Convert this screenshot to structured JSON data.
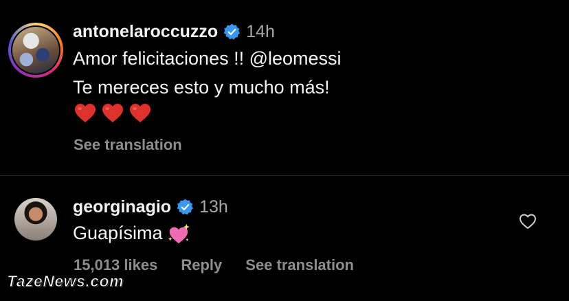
{
  "comments": [
    {
      "username": "antonelaroccuzzo",
      "time": "14h",
      "lines": [
        "Amor felicitaciones !! @leomessi",
        "Te mereces esto y mucho más!"
      ],
      "emoji": [
        "red-heart",
        "red-heart",
        "red-heart"
      ],
      "see_translation": "See translation"
    },
    {
      "username": "georginagio",
      "time": "13h",
      "text": "Guapísima",
      "emoji": "sparkling-heart",
      "likes": "15,013 likes",
      "reply": "Reply",
      "see_translation": "See translation"
    }
  ],
  "watermark": "TazeNews.com",
  "colors": {
    "background": "#000000",
    "verified": "#3897f0",
    "meta": "#8e8e8e",
    "divider": "#262626"
  }
}
